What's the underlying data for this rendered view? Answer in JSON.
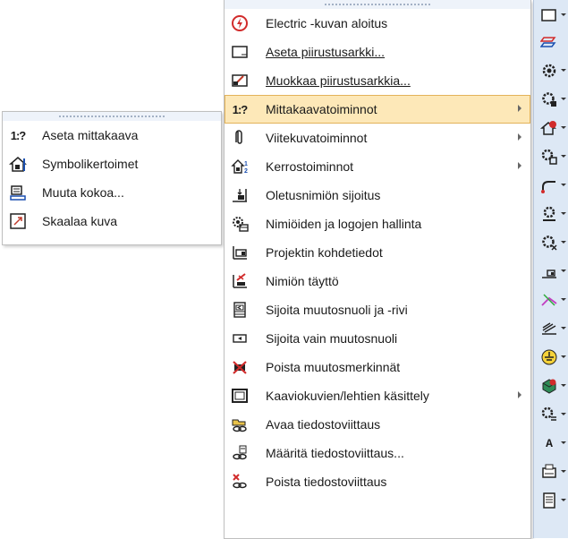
{
  "submenu": {
    "items": [
      {
        "label": "Aseta mittakaava",
        "icon": "scale-ratio-icon"
      },
      {
        "label": "Symbolikertoimet",
        "icon": "symbol-factor-icon"
      },
      {
        "label": "Muuta kokoa...",
        "icon": "resize-icon"
      },
      {
        "label": "Skaalaa kuva",
        "icon": "scale-drawing-icon"
      }
    ]
  },
  "menu": {
    "items": [
      {
        "label": "Electric -kuvan aloitus",
        "icon": "electric-start-icon",
        "submenu": false
      },
      {
        "label": "Aseta piirustusarkki...",
        "icon": "drawing-sheet-icon",
        "submenu": false
      },
      {
        "label": "Muokkaa piirustusarkkia...",
        "icon": "edit-sheet-icon",
        "submenu": false
      },
      {
        "label": "Mittakaavatoiminnot",
        "icon": "scale-ratio-icon",
        "submenu": true,
        "highlighted": true
      },
      {
        "label": "Viitekuvatoiminnot",
        "icon": "paperclip-icon",
        "submenu": true
      },
      {
        "label": "Kerrostoiminnot",
        "icon": "layers-icon",
        "submenu": true
      },
      {
        "label": "Oletusnimiön sijoitus",
        "icon": "title-block-place-icon",
        "submenu": false
      },
      {
        "label": "Nimiöiden ja logojen hallinta",
        "icon": "title-logo-manage-icon",
        "submenu": false
      },
      {
        "label": "Projektin kohdetiedot",
        "icon": "project-info-icon",
        "submenu": false
      },
      {
        "label": "Nimiön täyttö",
        "icon": "title-fill-icon",
        "submenu": false
      },
      {
        "label": "Sijoita muutosnuoli ja -rivi",
        "icon": "revision-arrow-row-icon",
        "submenu": false
      },
      {
        "label": "Sijoita vain muutosnuoli",
        "icon": "revision-arrow-icon",
        "submenu": false
      },
      {
        "label": "Poista muutosmerkinnät",
        "icon": "delete-revision-icon",
        "submenu": false
      },
      {
        "label": "Kaaviokuvien/lehtien käsittely",
        "icon": "diagram-sheets-icon",
        "submenu": true
      },
      {
        "label": "Avaa tiedostoviittaus",
        "icon": "open-file-ref-icon",
        "submenu": false
      },
      {
        "label": "Määritä tiedostoviittaus...",
        "icon": "define-file-ref-icon",
        "submenu": false
      },
      {
        "label": "Poista tiedostoviittaus",
        "icon": "delete-file-ref-icon",
        "submenu": false
      }
    ]
  },
  "toolbar": {
    "text_icon_label": "A"
  },
  "colors": {
    "highlight_bg": "#fde8b8",
    "highlight_border": "#e3b35a",
    "toolbar_bg": "#dde8f5"
  }
}
